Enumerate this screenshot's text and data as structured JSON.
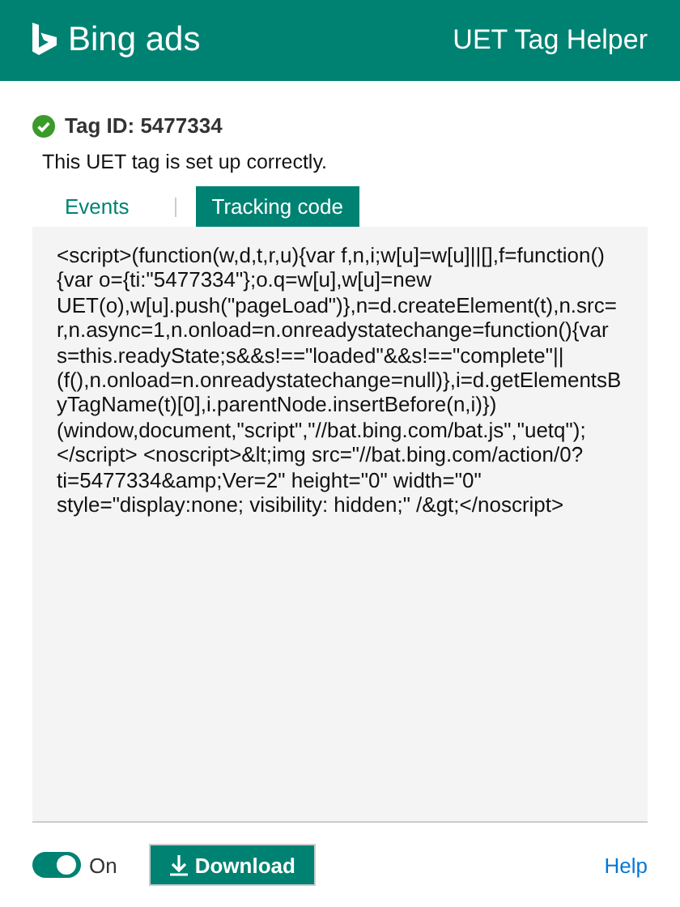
{
  "header": {
    "logo": "Bing ads",
    "title": "UET Tag Helper"
  },
  "tag": {
    "label": "Tag ID: 5477334",
    "status_ok": true,
    "message": "This UET tag is set up correctly."
  },
  "tabs": [
    {
      "label": "Events",
      "selected": false
    },
    {
      "label": "Tracking code",
      "selected": true
    }
  ],
  "code": "<script>(function(w,d,t,r,u){var f,n,i;w[u]=w[u]||[],f=function(){var o={ti:\"5477334\"};o.q=w[u],w[u]=new UET(o),w[u].push(\"pageLoad\")},n=d.createElement(t),n.src=r,n.async=1,n.onload=n.onreadystatechange=function(){var s=this.readyState;s&&s!==\"loaded\"&&s!==\"complete\"||(f(),n.onload=n.onreadystatechange=null)},i=d.getElementsByTagName(t)[0],i.parentNode.insertBefore(n,i)})(window,document,\"script\",\"//bat.bing.com/bat.js\",\"uetq\");</script> <noscript>&lt;img src=\"//bat.bing.com/action/0?ti=5477334&amp;Ver=2\" height=\"0\" width=\"0\" style=\"display:none; visibility: hidden;\" /&gt;</noscript>",
  "footer": {
    "toggle": {
      "label": "On",
      "on": true
    },
    "download": "Download",
    "help": "Help"
  }
}
